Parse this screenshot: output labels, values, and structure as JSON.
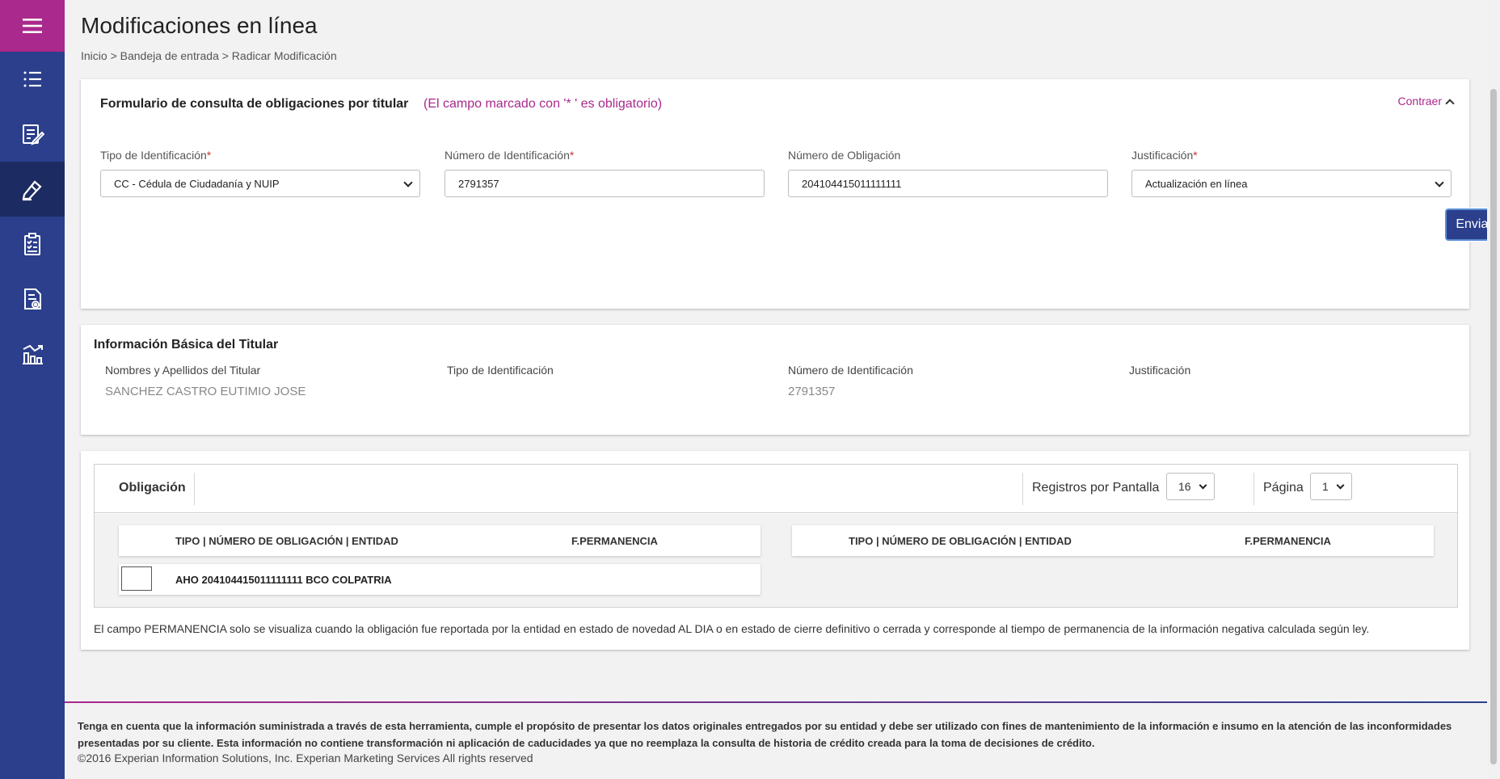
{
  "page": {
    "title": "Modificaciones en línea",
    "breadcrumb": "Inicio > Bandeja de entrada > Radicar Modificación"
  },
  "sidebar": {
    "items": [
      {
        "icon": "list-icon"
      },
      {
        "icon": "edit-document-icon"
      },
      {
        "icon": "tag-edit-icon",
        "active": true
      },
      {
        "icon": "checklist-icon"
      },
      {
        "icon": "document-settings-icon"
      },
      {
        "icon": "reports-icon"
      }
    ]
  },
  "form": {
    "title": "Formulario de consulta de obligaciones por titular",
    "note": "(El campo marcado con '* ' es obligatorio)",
    "collapse_label": "Contraer",
    "required_mark": "*",
    "fields": [
      {
        "label": "Tipo de Identificación",
        "required": true,
        "value": "CC - Cédula de Ciudadanía y NUIP",
        "type": "select"
      },
      {
        "label": "Número de Identificación",
        "required": true,
        "value": "2791357",
        "type": "input"
      },
      {
        "label": "Número de Obligación",
        "required": false,
        "value": "204104415011111111",
        "type": "input"
      },
      {
        "label": "Justificación",
        "required": true,
        "value": "Actualización en línea",
        "type": "select"
      }
    ],
    "submit_label": "Enviar"
  },
  "titular": {
    "title": "Información Básica del Titular",
    "columns": [
      {
        "header": "Nombres y Apellidos del Titular",
        "value": "SANCHEZ CASTRO EUTIMIO JOSE"
      },
      {
        "header": "Tipo de Identificación",
        "value": ""
      },
      {
        "header": "Número de Identificación",
        "value": "2791357"
      },
      {
        "header": "Justificación",
        "value": ""
      }
    ]
  },
  "obligaciones": {
    "label": "Obligación",
    "registros_label": "Registros por Pantalla",
    "registros_value": "16",
    "pagina_label": "Página",
    "pagina_value": "1",
    "columns": [
      "TIPO | NÚMERO DE OBLIGACIÓN | ENTIDAD",
      "F.PERMANENCIA"
    ],
    "rows": [
      {
        "text": "AHO 204104415011111111 BCO COLPATRIA",
        "permanencia": ""
      }
    ],
    "note": "El campo PERMANENCIA solo se visualiza cuando la obligación fue reportada por la entidad en estado de novedad AL DIA o en estado de cierre definitivo o cerrada y corresponde al tiempo de permanencia de la información negativa calculada según ley."
  },
  "footer": {
    "disclaimer": "Tenga en cuenta que la información suministrada a través de esta herramienta, cumple el propósito de presentar los datos originales entregados por su entidad y debe ser utilizado con fines de mantenimiento de la información e insumo en la atención de las inconformidades presentadas por su cliente. Esta información no contiene transformación ni aplicación de caducidades ya que no reemplaza la consulta de historia de crédito creada para la toma de decisiones de crédito.",
    "copyright": "©2016 Experian Information Solutions, Inc. Experian Marketing Services All rights reserved"
  },
  "colors": {
    "sidebar": "#2b3f8c",
    "sidebar_active": "#1c2b62",
    "accent": "#a9298c",
    "button": "#2b3f8c",
    "required": "#c0392b"
  }
}
